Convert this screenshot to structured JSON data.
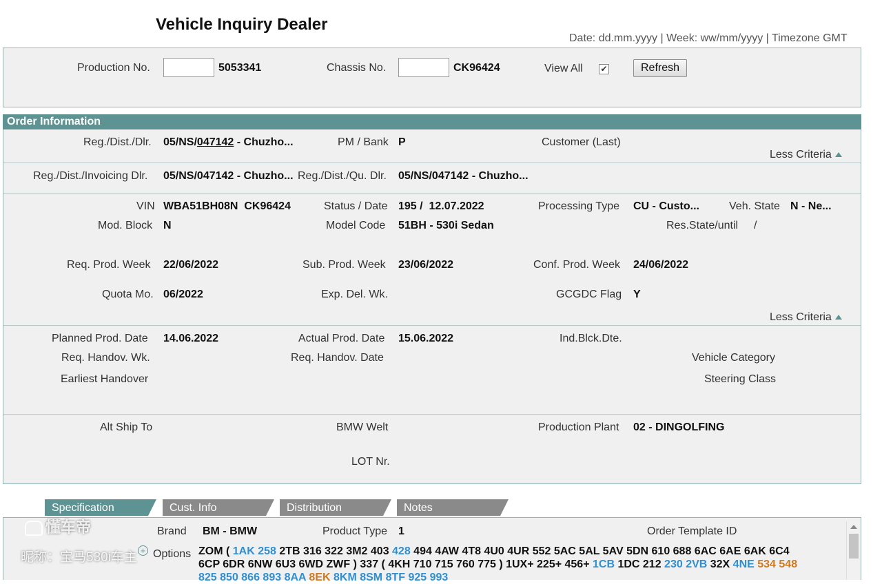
{
  "header": {
    "title": "Vehicle Inquiry Dealer",
    "meta": "Date: dd.mm.yyyy | Week: ww/mm/yyyy | Timezone GMT"
  },
  "search": {
    "production_label": "Production No.",
    "production_value": "5053341",
    "chassis_label": "Chassis No.",
    "chassis_value": "CK96424",
    "view_all_label": "View All",
    "view_all_checked": "✔",
    "refresh_label": "Refresh"
  },
  "order": {
    "header": "Order Information",
    "reg_dist_dlr_label": "Reg./Dist./Dlr.",
    "reg_dist_dlr_prefix": "05/NS/",
    "reg_dist_dlr_link": "047142",
    "reg_dist_dlr_suffix": " - Chuzho...",
    "pm_bank_label": "PM / Bank",
    "pm_bank_value": "P",
    "customer_label": "Customer (Last)",
    "less_criteria_1": "Less Criteria",
    "invoicing_label": "Reg./Dist./Invoicing Dlr.",
    "invoicing_value": "05/NS/047142 - Chuzho...",
    "qu_dlr_label": "Reg./Dist./Qu. Dlr.",
    "qu_dlr_value": "05/NS/047142 - Chuzho...",
    "vin_label": "VIN",
    "vin_value": "WBA51BH08N  CK96424",
    "status_label": "Status / Date",
    "status_value": "195 /  12.07.2022",
    "proc_type_label": "Processing Type",
    "proc_type_value": "CU - Custo...",
    "veh_state_label": "Veh. State",
    "veh_state_value": "N - Ne...",
    "mod_block_label": "Mod. Block",
    "mod_block_value": "N",
    "model_code_label": "Model Code",
    "model_code_value": "51BH - 530i Sedan",
    "res_state_label": "Res.State/until",
    "res_state_value": "/",
    "req_prod_week_label": "Req. Prod. Week",
    "req_prod_week_value": "22/06/2022",
    "sub_prod_week_label": "Sub. Prod. Week",
    "sub_prod_week_value": "23/06/2022",
    "conf_prod_week_label": "Conf. Prod. Week",
    "conf_prod_week_value": "24/06/2022",
    "quota_label": "Quota Mo.",
    "quota_value": "06/2022",
    "exp_del_label": "Exp. Del. Wk.",
    "gcgdc_label": "GCGDC Flag",
    "gcgdc_value": "Y",
    "less_criteria_2": "Less Criteria",
    "planned_prod_label": "Planned Prod. Date",
    "planned_prod_value": "14.06.2022",
    "actual_prod_label": "Actual Prod. Date",
    "actual_prod_value": "15.06.2022",
    "ind_blck_label": "Ind.Blck.Dte.",
    "req_handov_wk_label": "Req. Handov. Wk.",
    "req_handov_date_label": "Req. Handov. Date",
    "vehicle_category_label": "Vehicle Category",
    "earliest_handover_label": "Earliest Handover",
    "steering_class_label": "Steering Class",
    "alt_ship_label": "Alt Ship To",
    "bmw_welt_label": "BMW Welt",
    "prod_plant_label": "Production Plant",
    "prod_plant_value": "02 - DINGOLFING",
    "lot_label": "LOT Nr."
  },
  "tabs": [
    "Specification",
    "Cust. Info",
    "Distribution",
    "Notes"
  ],
  "spec": {
    "brand_label": "Brand",
    "brand_value": "BM - BMW",
    "product_type_label": "Product Type",
    "product_type_value": "1",
    "order_template_label": "Order Template ID",
    "options_label": "Options",
    "options_lines": [
      [
        {
          "t": "ZOM ( ",
          "c": ""
        },
        {
          "t": "1AK 258",
          "c": "blue"
        },
        {
          "t": " 2TB 316 322 3M2 403 ",
          "c": ""
        },
        {
          "t": "428",
          "c": "blue"
        },
        {
          "t": " 494 4AW 4T8 4U0 4UR 552 5AC 5AL 5AV 5DN 610 688 6AC 6AE 6AK 6C4",
          "c": ""
        }
      ],
      [
        {
          "t": "6CP 6DR 6NW 6U3 6WD ZWF ) 337 ( 4KH 710 715 760 775 ) 1UX+ 225+ 456+ ",
          "c": ""
        },
        {
          "t": "1CB",
          "c": "blue"
        },
        {
          "t": " 1DC 212 ",
          "c": ""
        },
        {
          "t": "230 2VB",
          "c": "blue"
        },
        {
          "t": " 32X ",
          "c": ""
        },
        {
          "t": "4NE",
          "c": "blue"
        },
        {
          "t": " ",
          "c": ""
        },
        {
          "t": "534 548",
          "c": "orange"
        }
      ],
      [
        {
          "t": "825 850 866 893 8AA ",
          "c": "blue"
        },
        {
          "t": "8EK",
          "c": "orange"
        },
        {
          "t": " 8KM 8SM 8TF 925 993",
          "c": "blue"
        }
      ]
    ]
  },
  "watermark": {
    "brand": "懂车帝",
    "nickname": "昵称：宝马530i车主"
  }
}
